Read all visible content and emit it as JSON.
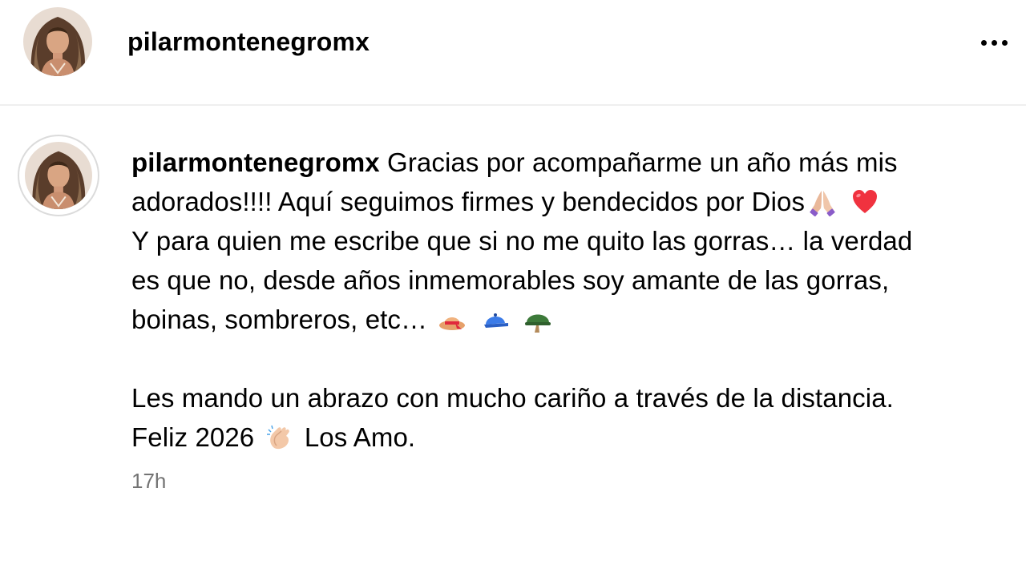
{
  "header": {
    "username": "pilarmontenegromx"
  },
  "caption": {
    "username": "pilarmontenegromx",
    "line1_text": "Gracias por acompañarme un año más mis",
    "line2_text": "adorados!!!! Aquí seguimos firmes y bendecidos por Dios",
    "line3_text": "Y para quien me escribe que si no me quito las gorras… la verdad",
    "line4_text": "es que no, desde años inmemorables soy amante de las gorras,",
    "line5_text": "boinas, sombreros, etc…",
    "line7_text": "Les mando un abrazo con mucho cariño a través de la distancia.",
    "line8_before": "Feliz 2026",
    "line8_after": "Los Amo."
  },
  "emojis": {
    "line2": [
      "folded-hands-icon",
      "red-heart-icon"
    ],
    "line5": [
      "hat-icon",
      "cap-icon",
      "helmet-icon"
    ],
    "line8": [
      "clapping-hands-icon"
    ]
  },
  "timestamp": "17h",
  "colors": {
    "divider": "#efefef",
    "timestamp": "#737373",
    "avatar_ring": "#dbdbdb"
  }
}
